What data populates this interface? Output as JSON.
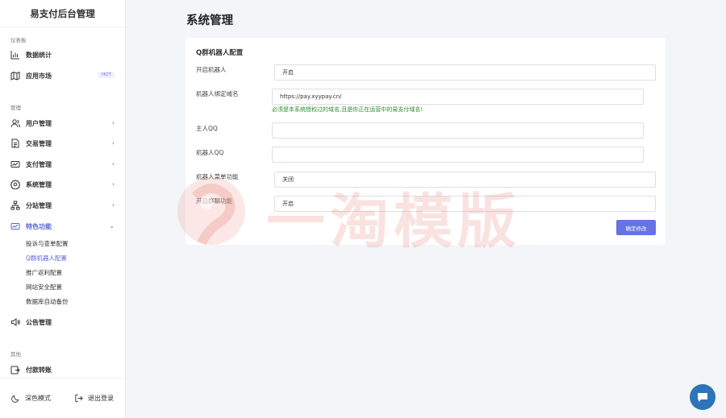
{
  "sidebar": {
    "brand": "易支付后台管理",
    "section_dashboard": "仪表板",
    "section_manage": "管理",
    "section_other": "其他",
    "items": {
      "stats": "数据统计",
      "market": "应用市场",
      "market_badge": "HOT",
      "users": "用户管理",
      "trade": "交易管理",
      "pay": "支付管理",
      "system": "系统管理",
      "substation": "分站管理",
      "features": "特色功能",
      "notice": "公告管理",
      "transfer": "付款转账"
    },
    "features_sub": [
      "投诉与查单配置",
      "Q群机器人配置",
      "推广返利配置",
      "网站安全配置",
      "数据库自动备份"
    ],
    "active_sub_index": 1,
    "footer": {
      "dark_mode": "深色模式",
      "logout": "退出登录"
    }
  },
  "page": {
    "title": "系统管理"
  },
  "form": {
    "title": "Q群机器人配置",
    "fields": {
      "bot_enable_label": "开启机器人",
      "bot_enable_value": "开启",
      "bot_domain_label": "机器人绑定域名",
      "bot_domain_value": "https://pay.xyypay.cn/",
      "bot_domain_hint": "必须是本系统授权过的域名,且是你正在运营中的易支付域名!",
      "master_qq_label": "主人QQ",
      "master_qq_value": "",
      "bot_qq_label": "机器人QQ",
      "bot_qq_value": "",
      "menu_label": "机器人菜单功能",
      "menu_value": "关闭",
      "group_chat_label": "开启群聊功能",
      "group_chat_value": "开启"
    },
    "submit_label": "确定修改"
  },
  "watermark": {
    "text": "一淘模版"
  },
  "colors": {
    "accent": "#6673e4",
    "active_nav": "#5b66d6",
    "hint": "#2e8b2e",
    "chat_fab": "#2d74b8"
  },
  "icons": {
    "stats": "bar-chart-icon",
    "market": "map-icon",
    "users": "users-icon",
    "trade": "document-icon",
    "pay": "card-icon",
    "system": "gear-icon",
    "substation": "sitemap-icon",
    "features": "chart-card-icon",
    "notice": "speaker-icon",
    "transfer": "wallet-icon",
    "dark_mode": "moon-icon",
    "logout": "logout-icon",
    "chat": "chat-icon"
  }
}
